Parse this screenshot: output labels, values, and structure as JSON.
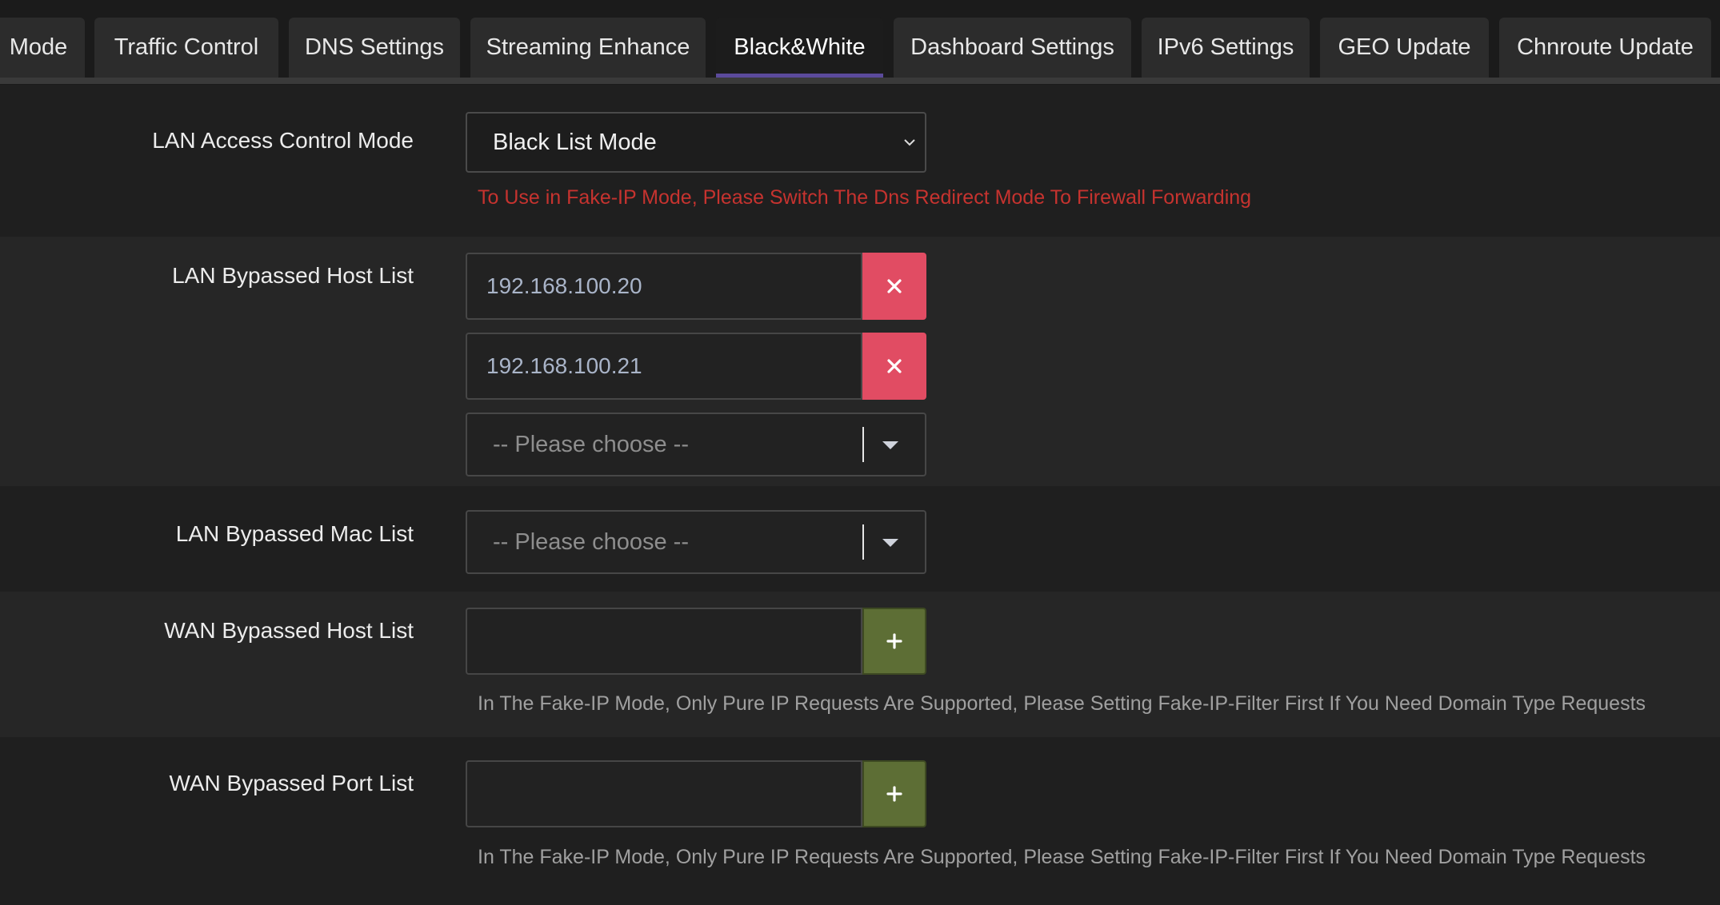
{
  "tabs": [
    {
      "label": "Mode",
      "active": false
    },
    {
      "label": "Traffic Control",
      "active": false
    },
    {
      "label": "DNS Settings",
      "active": false
    },
    {
      "label": "Streaming Enhance",
      "active": false
    },
    {
      "label": "Black&White",
      "active": true
    },
    {
      "label": "Dashboard Settings",
      "active": false
    },
    {
      "label": "IPv6 Settings",
      "active": false
    },
    {
      "label": "GEO Update",
      "active": false
    },
    {
      "label": "Chnroute Update",
      "active": false
    }
  ],
  "access_mode": {
    "label": "LAN Access Control Mode",
    "value": "Black List Mode",
    "warning": "To Use in Fake-IP Mode, Please Switch The Dns Redirect Mode To Firewall Forwarding"
  },
  "bypassed_hosts": {
    "label": "LAN Bypassed Host List",
    "entries": [
      "192.168.100.20",
      "192.168.100.21"
    ],
    "remove_icon": "close-icon",
    "chooser_placeholder": "-- Please choose --"
  },
  "bypassed_macs": {
    "label": "LAN Bypassed Mac List",
    "chooser_placeholder": "-- Please choose --"
  },
  "wan_hosts": {
    "label": "WAN Bypassed Host List",
    "input_value": "",
    "add_icon": "plus-icon",
    "hint": "In The Fake-IP Mode, Only Pure IP Requests Are Supported, Please Setting Fake-IP-Filter First If You Need Domain Type Requests"
  },
  "wan_ports": {
    "label": "WAN Bypassed Port List",
    "input_value": "",
    "add_icon": "plus-icon",
    "hint": "In The Fake-IP Mode, Only Pure IP Requests Are Supported, Please Setting Fake-IP-Filter First If You Need Domain Type Requests"
  },
  "colors": {
    "accent": "#5b4a9b",
    "remove_button": "#e14c63",
    "add_button": "#5d6e35",
    "warning_text": "#c6332f"
  }
}
